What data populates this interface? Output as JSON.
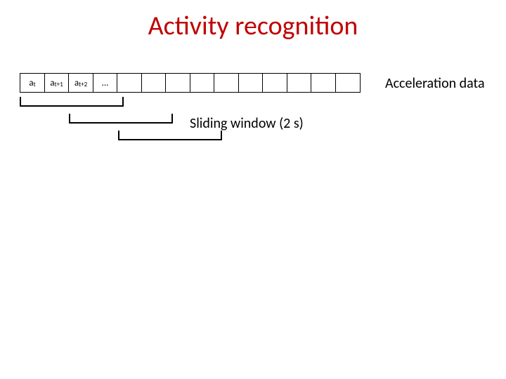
{
  "title": "Activity recognition",
  "data_label": "Acceleration data",
  "window_label": "Sliding window (2 s)",
  "cells": {
    "c0_base": "a",
    "c0_sub": "t",
    "c1_base": "a",
    "c1_sub": "t+1",
    "c2_base": "a",
    "c2_sub": "t+2",
    "c3_base": "...",
    "c3_sub": ""
  }
}
